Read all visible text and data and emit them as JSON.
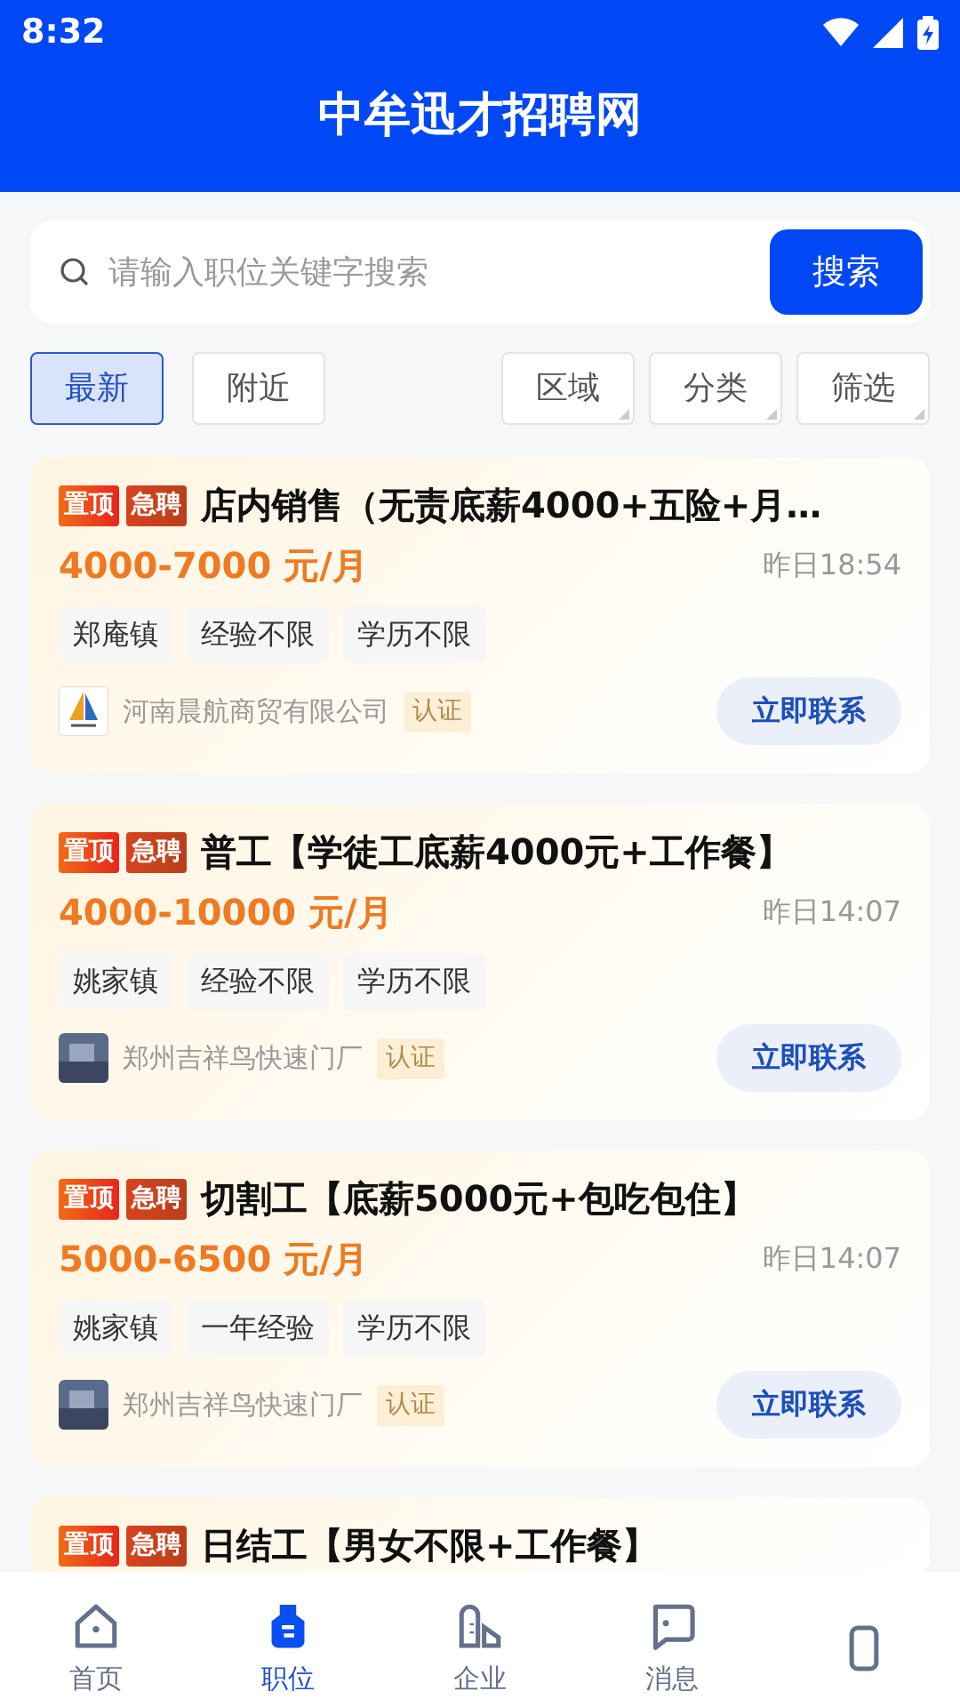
{
  "status_bar": {
    "time": "8:32"
  },
  "header": {
    "title": "中牟迅才招聘网"
  },
  "search": {
    "placeholder": "请输入职位关键字搜索",
    "button": "搜索"
  },
  "sort_tabs": [
    {
      "label": "最新",
      "selected": true
    },
    {
      "label": "附近",
      "selected": false
    }
  ],
  "filters": [
    "区域",
    "分类",
    "筛选"
  ],
  "jobs": [
    {
      "badges": [
        "置顶",
        "急聘"
      ],
      "title": "店内销售（无责底薪4000+五险+月…",
      "salary": "4000-7000 元/月",
      "time": "昨日18:54",
      "tags": [
        "郑庵镇",
        "经验不限",
        "学历不限"
      ],
      "company": "河南晨航商贸有限公司",
      "verified": "认证",
      "contact": "立即联系",
      "kind": "sail"
    },
    {
      "badges": [
        "置顶",
        "急聘"
      ],
      "title": "普工【学徒工底薪4000元+工作餐】",
      "salary": "4000-10000 元/月",
      "time": "昨日14:07",
      "tags": [
        "姚家镇",
        "经验不限",
        "学历不限"
      ],
      "company": "郑州吉祥鸟快速门厂",
      "verified": "认证",
      "contact": "立即联系",
      "kind": "photo"
    },
    {
      "badges": [
        "置顶",
        "急聘"
      ],
      "title": "切割工【底薪5000元+包吃包住】",
      "salary": "5000-6500 元/月",
      "time": "昨日14:07",
      "tags": [
        "姚家镇",
        "一年经验",
        "学历不限"
      ],
      "company": "郑州吉祥鸟快速门厂",
      "verified": "认证",
      "contact": "立即联系",
      "kind": "photo"
    },
    {
      "badges": [
        "置顶",
        "急聘"
      ],
      "title": "日结工【男女不限+工作餐】"
    }
  ],
  "bottom_nav": [
    {
      "label": "首页",
      "selected": false
    },
    {
      "label": "职位",
      "selected": true
    },
    {
      "label": "企业",
      "selected": false
    },
    {
      "label": "消息",
      "selected": false
    },
    {
      "selected": false
    }
  ]
}
